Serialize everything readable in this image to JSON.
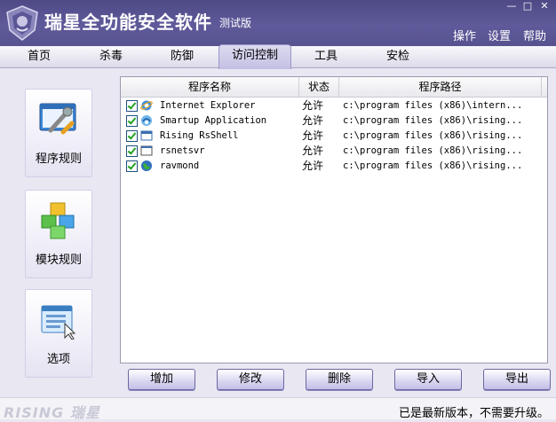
{
  "title": {
    "main": "瑞星全功能安全软件",
    "edition": "测试版"
  },
  "window_buttons": [
    {
      "name": "minimize-button",
      "glyph": "—"
    },
    {
      "name": "maximize-button",
      "glyph": "□"
    },
    {
      "name": "close-button",
      "glyph": "✕"
    }
  ],
  "top_menu": [
    "操作",
    "设置",
    "帮助"
  ],
  "tabs": [
    "首页",
    "杀毒",
    "防御",
    "访问控制",
    "工具",
    "安检"
  ],
  "active_tab": "访问控制",
  "sidebar": [
    {
      "label": "程序规则",
      "icon": "program-rules-icon"
    },
    {
      "label": "模块规则",
      "icon": "module-rules-icon"
    },
    {
      "label": "选项",
      "icon": "options-icon"
    }
  ],
  "table": {
    "columns": [
      "程序名称",
      "状态",
      "程序路径"
    ],
    "rows": [
      {
        "name": "Internet Explorer",
        "status": "允许",
        "path": "c:\\program files (x86)\\intern...",
        "icon": "internet-explorer-icon",
        "checked": true
      },
      {
        "name": "Smartup Application",
        "status": "允许",
        "path": "c:\\program files (x86)\\rising...",
        "icon": "smartup-icon",
        "checked": true
      },
      {
        "name": "Rising RsShell",
        "status": "允许",
        "path": "c:\\program files (x86)\\rising...",
        "icon": "rsshell-icon",
        "checked": true
      },
      {
        "name": "rsnetsvr",
        "status": "允许",
        "path": "c:\\program files (x86)\\rising...",
        "icon": "rsnetsvr-icon",
        "checked": true
      },
      {
        "name": "ravmond",
        "status": "允许",
        "path": "c:\\program files (x86)\\rising...",
        "icon": "ravmond-icon",
        "checked": true
      }
    ]
  },
  "buttons": [
    "增加",
    "修改",
    "删除",
    "导入",
    "导出"
  ],
  "status_bar": {
    "brand": "RISING 瑞星",
    "message": "已是最新版本，不需要升级。"
  },
  "colors": {
    "title_bar": "#57528f",
    "tab_active": "#c4c0e3",
    "background": "#e9e7f2"
  }
}
